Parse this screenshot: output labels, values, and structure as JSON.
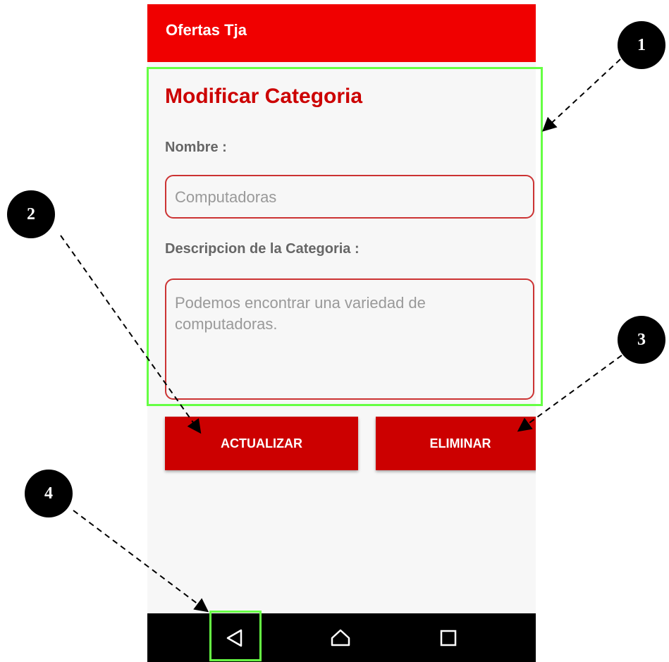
{
  "app": {
    "title": "Ofertas Tja"
  },
  "form": {
    "title": "Modificar Categoria",
    "name_label": "Nombre :",
    "name_value": "Computadoras",
    "description_label": "Descripcion de la Categoria :",
    "description_value": "Podemos encontrar una variedad de computadoras."
  },
  "buttons": {
    "update": "ACTUALIZAR",
    "delete": "ELIMINAR"
  },
  "navigation": {
    "icons": [
      "back-icon",
      "home-icon",
      "recent-apps-icon"
    ]
  },
  "annotations": {
    "markers": [
      "1",
      "2",
      "3",
      "4"
    ],
    "highlight_color": "#66ff44"
  },
  "colors": {
    "appbar": "#f00000",
    "accent": "#cc0000"
  }
}
